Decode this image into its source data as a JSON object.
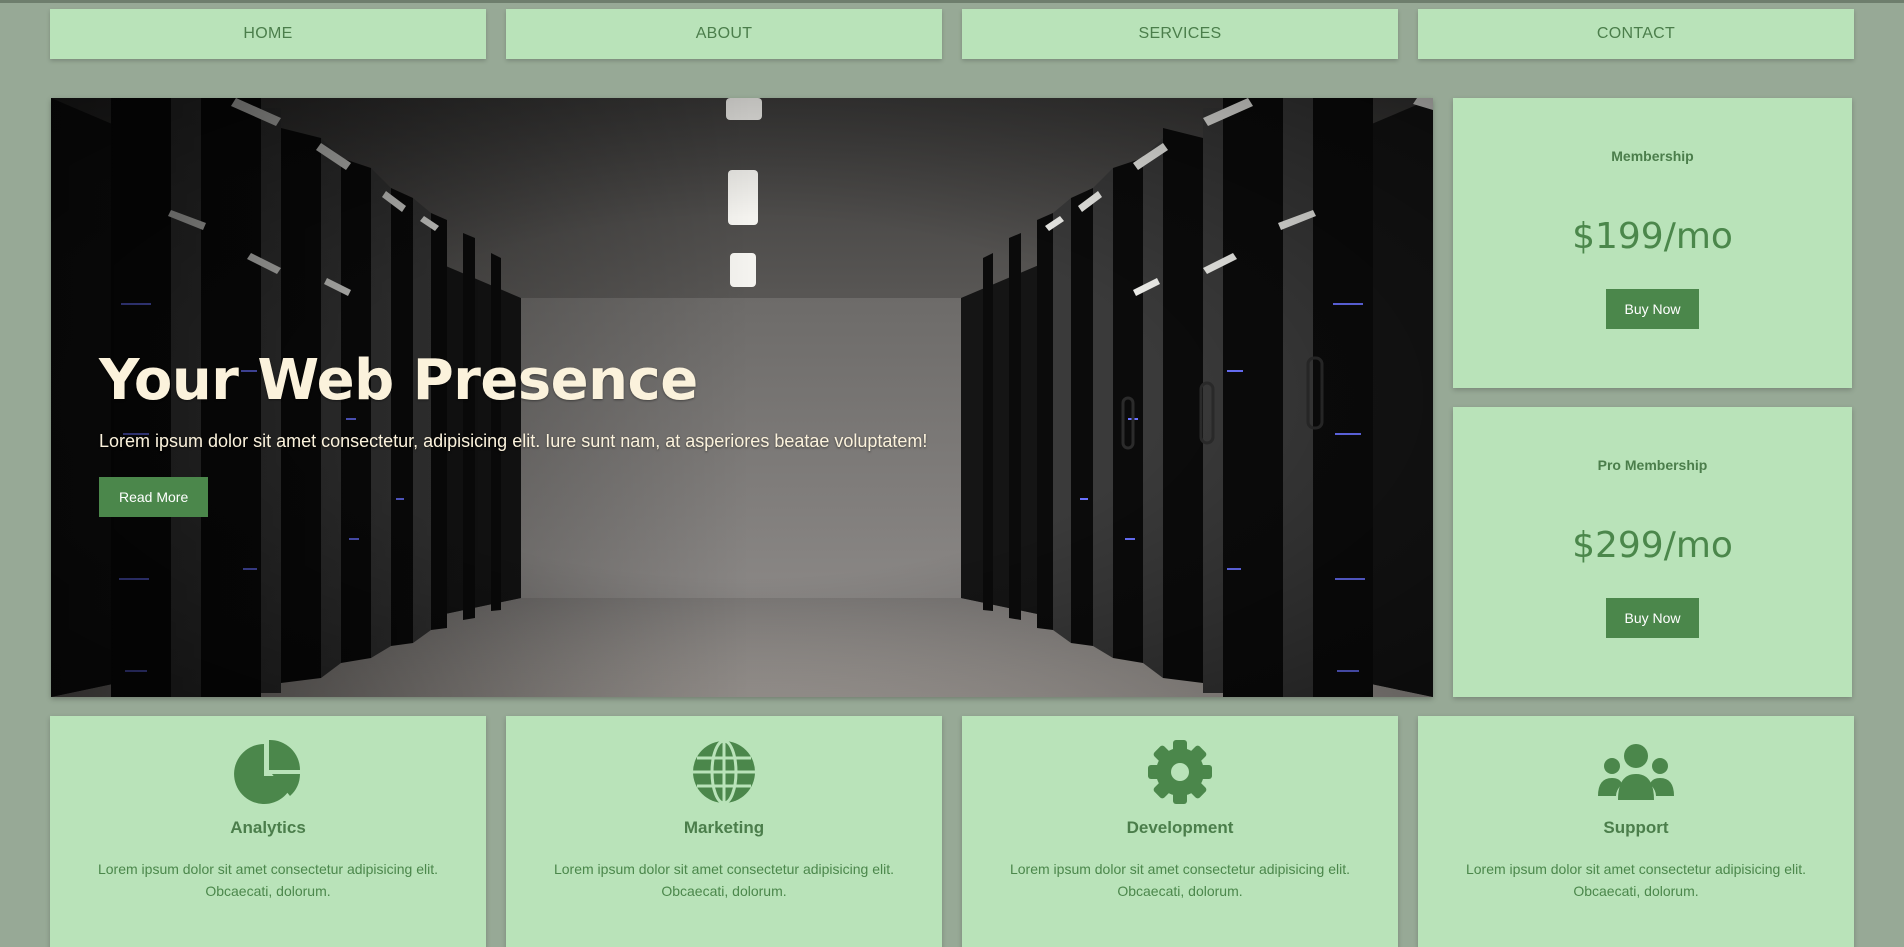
{
  "nav": {
    "items": [
      {
        "label": "HOME"
      },
      {
        "label": "ABOUT"
      },
      {
        "label": "SERVICES"
      },
      {
        "label": "CONTACT"
      }
    ]
  },
  "hero": {
    "title": "Your Web Presence",
    "text": "Lorem ipsum dolor sit amet consectetur, adipisicing elit. Iure sunt nam, at asperiores beatae voluptatem!",
    "button": "Read More"
  },
  "pricing": [
    {
      "name": "Membership",
      "price": "$199/mo",
      "button": "Buy Now"
    },
    {
      "name": "Pro Membership",
      "price": "$299/mo",
      "button": "Buy Now"
    }
  ],
  "features": [
    {
      "icon": "pie-chart-icon",
      "title": "Analytics",
      "text": "Lorem ipsum dolor sit amet consectetur adipisicing elit. Obcaecati, dolorum."
    },
    {
      "icon": "globe-icon",
      "title": "Marketing",
      "text": "Lorem ipsum dolor sit amet consectetur adipisicing elit. Obcaecati, dolorum."
    },
    {
      "icon": "gear-icon",
      "title": "Development",
      "text": "Lorem ipsum dolor sit amet consectetur adipisicing elit. Obcaecati, dolorum."
    },
    {
      "icon": "users-icon",
      "title": "Support",
      "text": "Lorem ipsum dolor sit amet consectetur adipisicing elit. Obcaecati, dolorum."
    }
  ],
  "colors": {
    "page_bg": "#97a996",
    "card_bg": "#b9e3b9",
    "accent": "#4b874b",
    "hero_text": "#fbf2dc"
  }
}
